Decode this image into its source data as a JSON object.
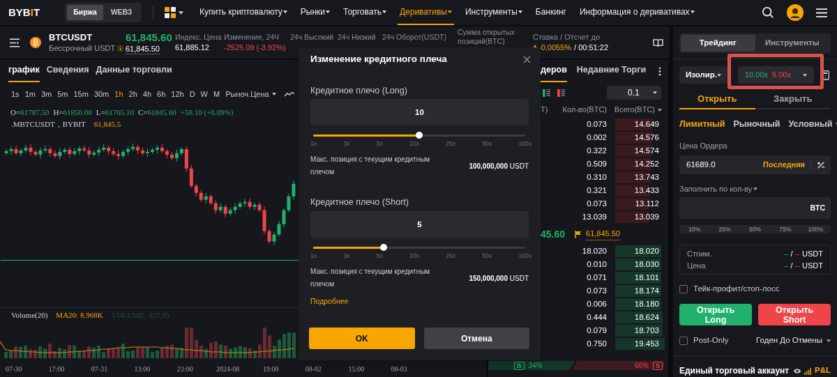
{
  "nav": {
    "logo": "BYBIT",
    "segments": [
      {
        "label": "Биржа",
        "selected": true
      },
      {
        "label": "WEB3",
        "selected": false
      }
    ],
    "menu": [
      {
        "label": "Купить криптовалюту",
        "selected": false,
        "has_menu": true
      },
      {
        "label": "Рынки",
        "selected": false,
        "has_menu": true
      },
      {
        "label": "Торговать",
        "selected": false,
        "has_menu": true
      },
      {
        "label": "Деривативы",
        "selected": true,
        "has_menu": true
      },
      {
        "label": "Инструменты",
        "selected": false,
        "has_menu": true
      },
      {
        "label": "Банкинг",
        "selected": false,
        "has_menu": false
      },
      {
        "label": "Информация о деривативах",
        "selected": false,
        "has_menu": true
      }
    ]
  },
  "ticker": {
    "symbol": "BTCUSDT",
    "subtitle": "Бессрочный USDT",
    "last_price": "61,845.60",
    "mark_price": "61,845.50",
    "stats": [
      {
        "label": "Индекс. Цена",
        "value": "61,885.12",
        "kind": "plain"
      },
      {
        "label": "Изменение, 24Ч",
        "value": "-2525.09 (-3.92%)",
        "kind": "down"
      },
      {
        "label": "24ч Высокий"
      },
      {
        "label": "24ч Низкий"
      },
      {
        "label": "24ч Оборот(USDT)"
      },
      {
        "label": "Сумма открытых позиций(BTC)"
      }
    ],
    "funding": {
      "label": "Ставка / Отсчет до",
      "rate": "-0.0055%",
      "countdown": "/ 00:51:22"
    }
  },
  "chart": {
    "tabs": [
      {
        "label": "график",
        "selected": true
      },
      {
        "label": "Сведения",
        "selected": false
      },
      {
        "label": "Данные торговли",
        "selected": false
      }
    ],
    "intervals": [
      {
        "label": "1s",
        "selected": false
      },
      {
        "label": "1m",
        "selected": false
      },
      {
        "label": "3m",
        "selected": false
      },
      {
        "label": "5m",
        "selected": false
      },
      {
        "label": "15m",
        "selected": false
      },
      {
        "label": "30m",
        "selected": false
      },
      {
        "label": "1h",
        "selected": true
      },
      {
        "label": "2h",
        "selected": false
      },
      {
        "label": "4h",
        "selected": false
      },
      {
        "label": "6h",
        "selected": false
      },
      {
        "label": "12h",
        "selected": false
      },
      {
        "label": "D",
        "selected": false
      },
      {
        "label": "W",
        "selected": false
      },
      {
        "label": "M",
        "selected": false
      }
    ],
    "price_type": "Рыноч.Цена",
    "ohlc": [
      {
        "key": "O=",
        "value": "61787.50"
      },
      {
        "key": "H=",
        "value": "61850.00"
      },
      {
        "key": "L=",
        "value": "61765.10"
      },
      {
        "key": "C=",
        "value": "61845.60"
      }
    ],
    "change": "+58.10 (+0.09%)",
    "symbol_line": {
      "name": ".MBTCUSDT，BYBIT",
      "price": "61,845.5"
    },
    "volume_legend": {
      "title": "Volume(20)",
      "ma": "MA20: 8.968K",
      "volume": "VOLUME: 437.99"
    },
    "x_labels": [
      "07-30",
      "17:00",
      "07-31",
      "13:00",
      "23:00",
      "2024-08",
      "19:00",
      "08-02",
      "15:00",
      "08-03"
    ]
  },
  "order_book": {
    "tabs": [
      {
        "label": "деров",
        "selected": true
      },
      {
        "label": "Недавние Торги",
        "selected": false
      }
    ],
    "precision": "0.1",
    "columns": [
      "T)",
      "Кол-во(BTC)",
      "Всего(BTC)"
    ],
    "asks": [
      {
        "qty": "0.073",
        "total": "14.649"
      },
      {
        "qty": "0.002",
        "total": "14.576"
      },
      {
        "qty": "0.322",
        "total": "14.574"
      },
      {
        "qty": "0.509",
        "total": "14.252"
      },
      {
        "qty": "0.310",
        "total": "13.743"
      },
      {
        "qty": "0.321",
        "total": "13.433"
      },
      {
        "qty": "0.073",
        "total": "13.112"
      },
      {
        "qty": "13.039",
        "total": "13.039"
      }
    ],
    "mid": {
      "last": "45.60",
      "mark": "61,845.50"
    },
    "bids": [
      {
        "qty": "18.020",
        "total": "18.020"
      },
      {
        "qty": "0.010",
        "total": "18.030"
      },
      {
        "qty": "0.071",
        "total": "18.101"
      },
      {
        "qty": "0.073",
        "total": "18.174"
      },
      {
        "qty": "0.006",
        "total": "18.180"
      },
      {
        "qty": "0.444",
        "total": "18.624"
      },
      {
        "qty": "0.079",
        "total": "18.703"
      },
      {
        "qty": "0.750",
        "total": "19.453"
      }
    ],
    "ratio": {
      "buy_badge": "B",
      "buy": "34%",
      "sell": "66%",
      "sell_badge": "S"
    }
  },
  "trade_panel": {
    "tabs": [
      {
        "label": "Трейдинг",
        "selected": true
      },
      {
        "label": "Инструменты",
        "selected": false
      }
    ],
    "margin_mode": "Изолир.",
    "leverage": {
      "long": "10.00x",
      "short": "5.00x"
    },
    "highlight_frame": true,
    "side_tabs": [
      {
        "label": "Открыть",
        "selected": true
      },
      {
        "label": "Закрыть",
        "selected": false
      }
    ],
    "order_types": [
      {
        "label": "Лимитный",
        "selected": true,
        "has_menu": false
      },
      {
        "label": "Рыночный",
        "selected": false,
        "has_menu": false
      },
      {
        "label": "Условный",
        "selected": false,
        "has_menu": true
      }
    ],
    "price_label": "Цена Ордера",
    "price_value": "61689.0",
    "price_hint": "Последняя",
    "qty_label": "Заполнить по кол-ву",
    "qty_unit": "BTC",
    "percents": [
      "10%",
      "25%",
      "50%",
      "75%",
      "100%"
    ],
    "summary": [
      {
        "label": "Стоим.",
        "long": "--",
        "sep": "/",
        "short": "--",
        "unit": "USDT"
      },
      {
        "label": "Цена",
        "long": "--",
        "sep": "/",
        "short": "--",
        "unit": "USDT"
      }
    ],
    "tpsl": {
      "label": "Тейк-профит/стоп-лосс",
      "checked": false
    },
    "buttons": [
      {
        "label": "Открыть Long",
        "kind": "long"
      },
      {
        "label": "Открыть Short",
        "kind": "short"
      }
    ],
    "post_only": {
      "label": "Post-Only",
      "checked": false
    },
    "tif": "Годен До Отмены",
    "account": {
      "title": "Единый торговый аккаунт",
      "pnl": "P&L"
    }
  },
  "leverage_dialog": {
    "title": "Изменение кредитного плеча",
    "sections": [
      {
        "label": "Кредитное плечо (Long)",
        "value": "10",
        "level": 0.5,
        "ticks": [
          "1x",
          "3x",
          "5x",
          "10x",
          "25x",
          "50x",
          "100x"
        ],
        "max_label": "Макс. позиция с текущим кредитным плечом",
        "max_value": "**100,000,000** USDT"
      },
      {
        "label": "Кредитное плечо (Short)",
        "value": "5",
        "level": 0.333,
        "ticks": [
          "1x",
          "3x",
          "5x",
          "10x",
          "25x",
          "50x",
          "100x"
        ],
        "max_label": "Макс. позиция с текущим кредитным плечом",
        "max_value": "**150,000,000** USDT"
      }
    ],
    "link": "Подробнее",
    "buttons": [
      {
        "label": "OK",
        "kind": "primary"
      },
      {
        "label": "Отмена",
        "kind": "secondary"
      }
    ]
  }
}
